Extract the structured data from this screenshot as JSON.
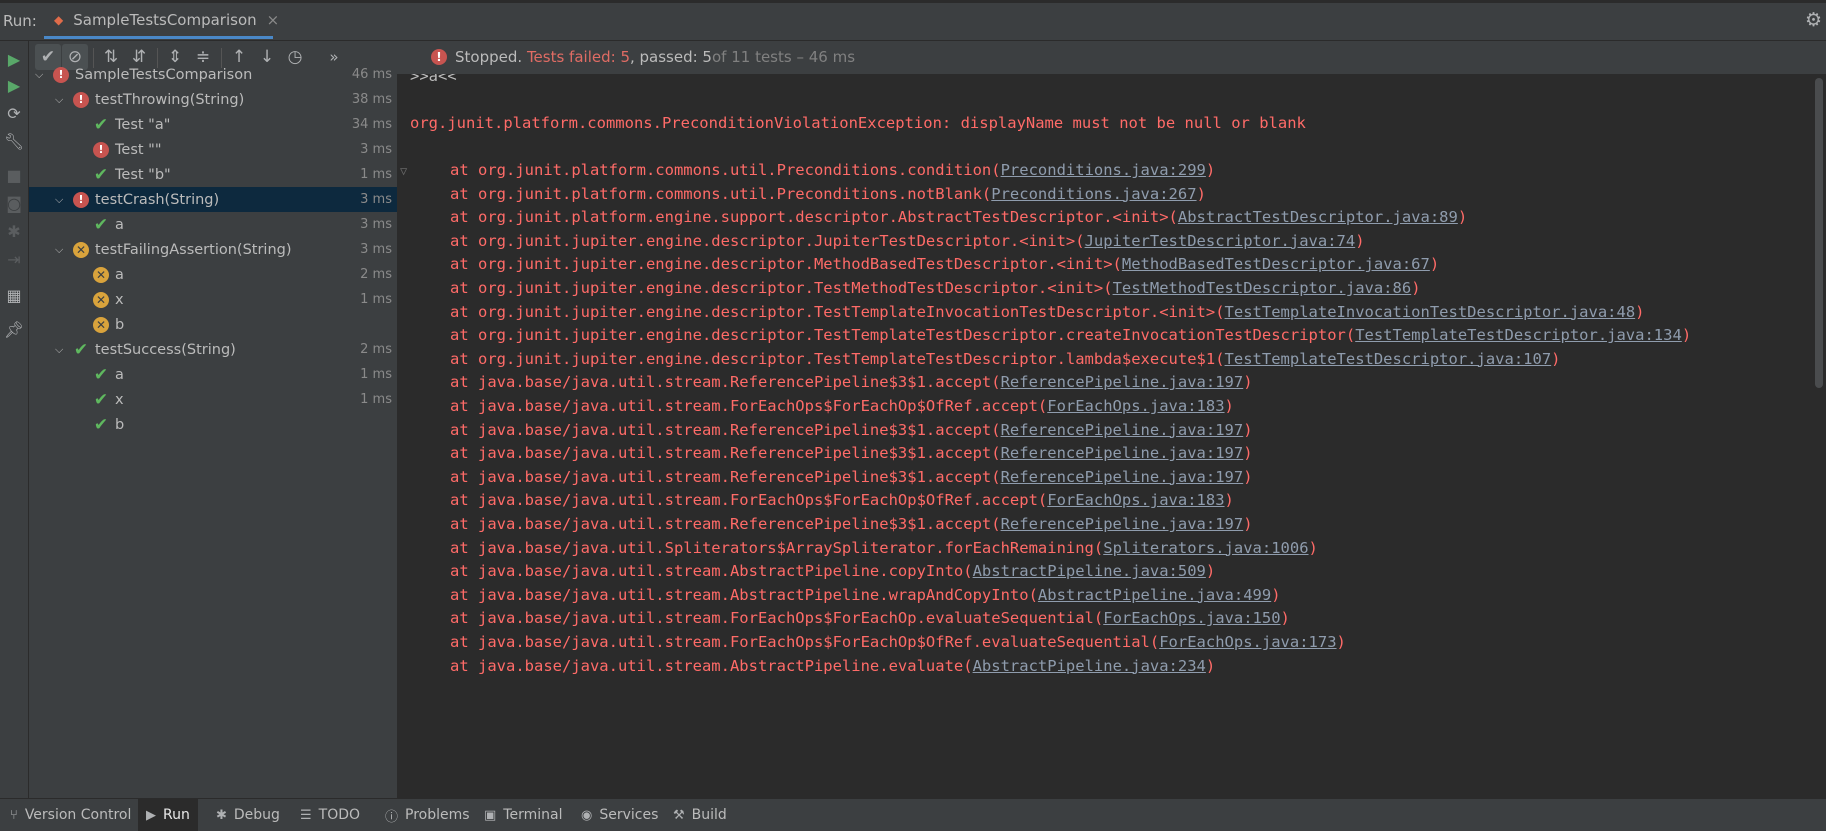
{
  "window": {
    "run_label": "Run:",
    "tab_title": "SampleTestsComparison",
    "tab_close": "×",
    "settings_icon": "gear-icon"
  },
  "toolbar": {
    "status_stopped": "Stopped.",
    "status_failed": "Tests failed: 5",
    "status_passed": ", passed: 5",
    "status_of": " of 11 tests – 46 ms",
    "more": "»",
    "buttons": [
      "show-passed",
      "show-ignored",
      "sort-alpha",
      "sort-duration",
      "expand-all",
      "collapse-all",
      "prev-failed",
      "next-failed",
      "history"
    ]
  },
  "tree": {
    "nodes": [
      {
        "label": "SampleTestsComparison",
        "duration": "46 ms",
        "status": "fail",
        "level": 0
      },
      {
        "label": "testThrowing(String)",
        "duration": "38 ms",
        "status": "fail",
        "level": 1
      },
      {
        "label": "Test \"a\"",
        "duration": "34 ms",
        "status": "pass",
        "level": 2
      },
      {
        "label": "Test \"\"",
        "duration": "3 ms",
        "status": "fail",
        "level": 2
      },
      {
        "label": "Test \"b\"",
        "duration": "1 ms",
        "status": "pass",
        "level": 2
      },
      {
        "label": "testCrash(String)",
        "duration": "3 ms",
        "status": "fail",
        "level": 1,
        "selected": true
      },
      {
        "label": "a",
        "duration": "3 ms",
        "status": "pass",
        "level": 2
      },
      {
        "label": "testFailingAssertion(String)",
        "duration": "3 ms",
        "status": "assert",
        "level": 1
      },
      {
        "label": "a",
        "duration": "2 ms",
        "status": "assert",
        "level": 2
      },
      {
        "label": "x",
        "duration": "1 ms",
        "status": "assert",
        "level": 2
      },
      {
        "label": "b",
        "duration": "",
        "status": "assert",
        "level": 2
      },
      {
        "label": "testSuccess(String)",
        "duration": "2 ms",
        "status": "pass",
        "level": 1
      },
      {
        "label": "a",
        "duration": "1 ms",
        "status": "pass",
        "level": 2
      },
      {
        "label": "x",
        "duration": "1 ms",
        "status": "pass",
        "level": 2
      },
      {
        "label": "b",
        "duration": "",
        "status": "pass",
        "level": 2
      }
    ]
  },
  "console": {
    "output_line": ">>a<<",
    "exception": "org.junit.platform.commons.PreconditionViolationException: displayName must not be null or blank",
    "stack": [
      {
        "text": "at org.junit.platform.commons.util.Preconditions.condition(",
        "link": "Preconditions.java:299"
      },
      {
        "text": "at org.junit.platform.commons.util.Preconditions.notBlank(",
        "link": "Preconditions.java:267"
      },
      {
        "text": "at org.junit.platform.engine.support.descriptor.AbstractTestDescriptor.<init>(",
        "link": "AbstractTestDescriptor.java:89"
      },
      {
        "text": "at org.junit.jupiter.engine.descriptor.JupiterTestDescriptor.<init>(",
        "link": "JupiterTestDescriptor.java:74"
      },
      {
        "text": "at org.junit.jupiter.engine.descriptor.MethodBasedTestDescriptor.<init>(",
        "link": "MethodBasedTestDescriptor.java:67"
      },
      {
        "text": "at org.junit.jupiter.engine.descriptor.TestMethodTestDescriptor.<init>(",
        "link": "TestMethodTestDescriptor.java:86"
      },
      {
        "text": "at org.junit.jupiter.engine.descriptor.TestTemplateInvocationTestDescriptor.<init>(",
        "link": "TestTemplateInvocationTestDescriptor.java:48"
      },
      {
        "text": "at org.junit.jupiter.engine.descriptor.TestTemplateTestDescriptor.createInvocationTestDescriptor(",
        "link": "TestTemplateTestDescriptor.java:134"
      },
      {
        "text": "at org.junit.jupiter.engine.descriptor.TestTemplateTestDescriptor.lambda$execute$1(",
        "link": "TestTemplateTestDescriptor.java:107"
      },
      {
        "text": "at java.base/java.util.stream.ReferencePipeline$3$1.accept(",
        "link": "ReferencePipeline.java:197"
      },
      {
        "text": "at java.base/java.util.stream.ForEachOps$ForEachOp$OfRef.accept(",
        "link": "ForEachOps.java:183"
      },
      {
        "text": "at java.base/java.util.stream.ReferencePipeline$3$1.accept(",
        "link": "ReferencePipeline.java:197"
      },
      {
        "text": "at java.base/java.util.stream.ReferencePipeline$3$1.accept(",
        "link": "ReferencePipeline.java:197"
      },
      {
        "text": "at java.base/java.util.stream.ReferencePipeline$3$1.accept(",
        "link": "ReferencePipeline.java:197"
      },
      {
        "text": "at java.base/java.util.stream.ForEachOps$ForEachOp$OfRef.accept(",
        "link": "ForEachOps.java:183"
      },
      {
        "text": "at java.base/java.util.stream.ReferencePipeline$3$1.accept(",
        "link": "ReferencePipeline.java:197"
      },
      {
        "text": "at java.base/java.util.Spliterators$ArraySpliterator.forEachRemaining(",
        "link": "Spliterators.java:1006"
      },
      {
        "text": "at java.base/java.util.stream.AbstractPipeline.copyInto(",
        "link": "AbstractPipeline.java:509"
      },
      {
        "text": "at java.base/java.util.stream.AbstractPipeline.wrapAndCopyInto(",
        "link": "AbstractPipeline.java:499"
      },
      {
        "text": "at java.base/java.util.stream.ForEachOps$ForEachOp.evaluateSequential(",
        "link": "ForEachOps.java:150"
      },
      {
        "text": "at java.base/java.util.stream.ForEachOps$ForEachOp$OfRef.evaluateSequential(",
        "link": "ForEachOps.java:173"
      },
      {
        "text": "at java.base/java.util.stream.AbstractPipeline.evaluate(",
        "link": "AbstractPipeline.java:234"
      }
    ]
  },
  "bottom_bar": {
    "items": [
      {
        "label": "Version Control",
        "icon": "branch-icon"
      },
      {
        "label": "Run",
        "icon": "play-icon",
        "active": true
      },
      {
        "label": "Debug",
        "icon": "bug-icon"
      },
      {
        "label": "TODO",
        "icon": "list-icon"
      },
      {
        "label": "Problems",
        "icon": "info-icon"
      },
      {
        "label": "Terminal",
        "icon": "terminal-icon"
      },
      {
        "label": "Services",
        "icon": "services-icon"
      },
      {
        "label": "Build",
        "icon": "hammer-icon"
      }
    ]
  },
  "colors": {
    "error_text": "#ff6b68",
    "link": "#8f9cad",
    "pass_icon": "#5fb85f",
    "fail_icon": "#c75450",
    "assert_icon": "#d9a33c",
    "selection": "#0d293e",
    "tab_underline": "#4a88c7"
  }
}
